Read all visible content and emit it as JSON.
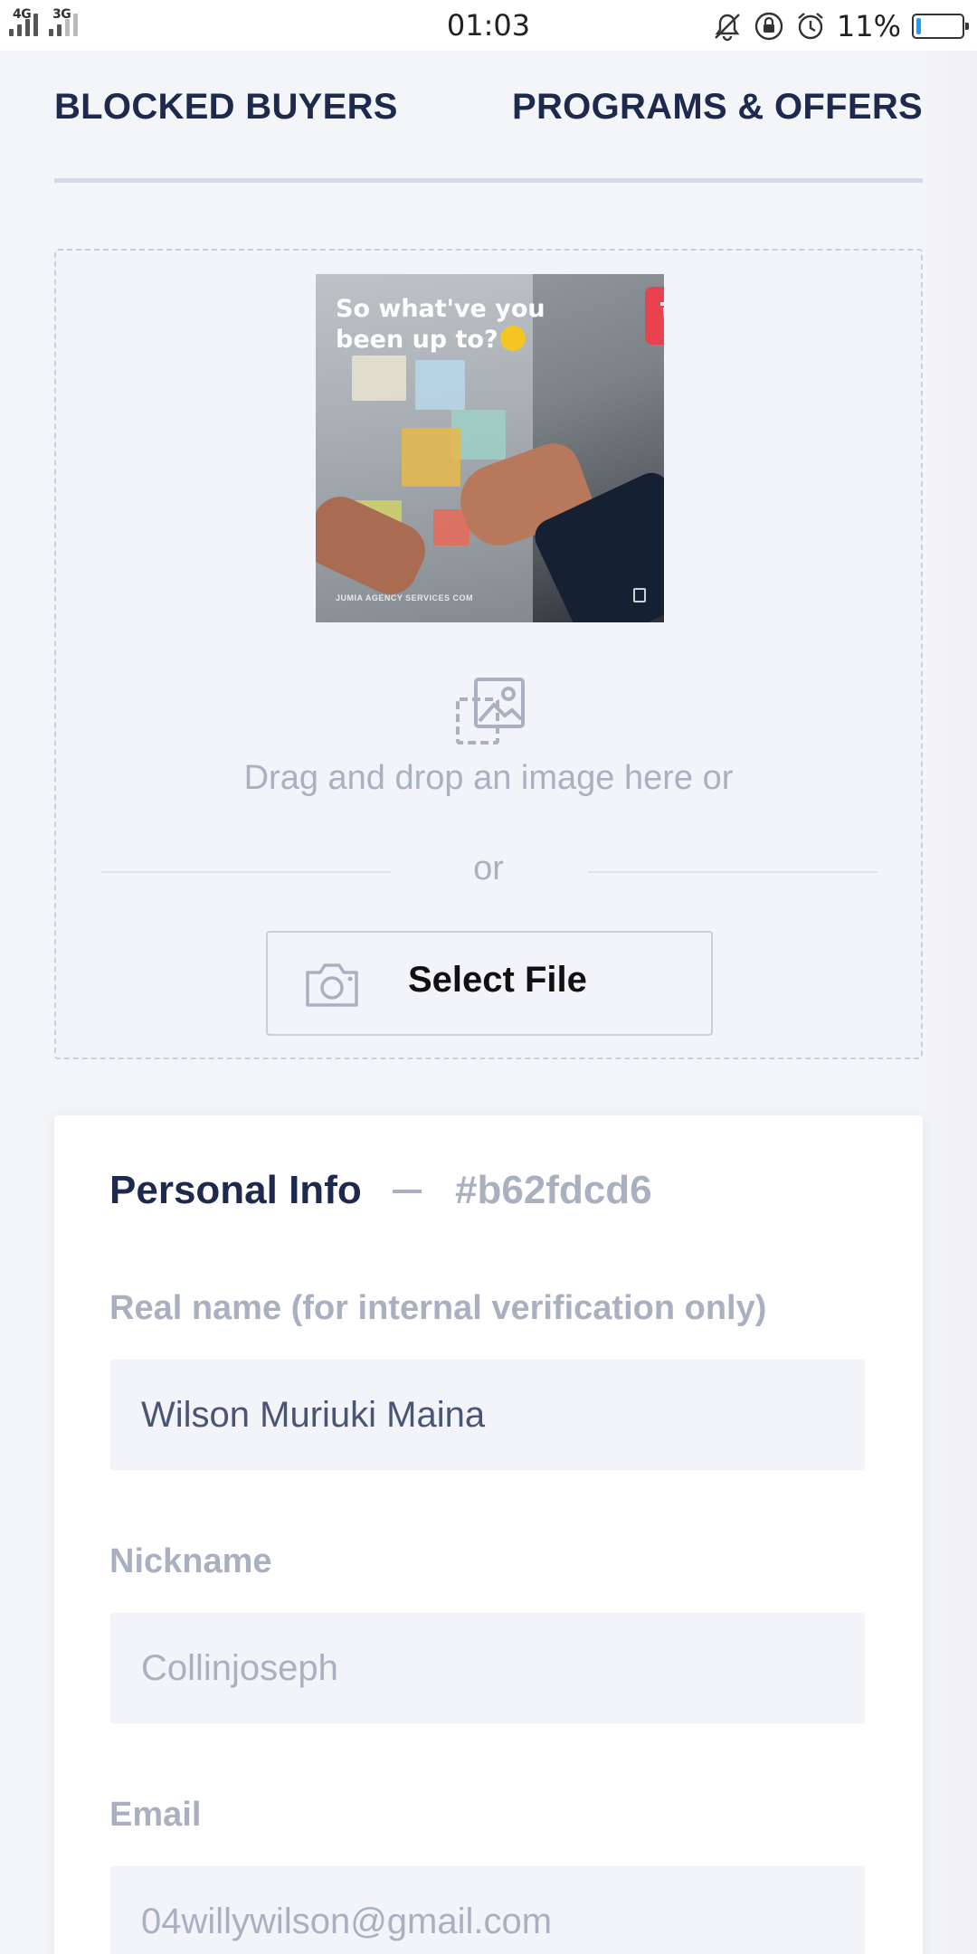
{
  "status_bar": {
    "network_1": "4G",
    "network_2": "3G",
    "time": "01:03",
    "battery": "11%",
    "battery_level": 0.11,
    "icons": [
      "mute-bell-icon",
      "lock-rotation-icon",
      "alarm-icon",
      "battery-icon"
    ]
  },
  "tabs": {
    "left": "BLOCKED BUYERS",
    "right": "PROGRAMS & OFFERS"
  },
  "upload": {
    "preview_caption": "So what've you been up to?",
    "preview_watermark": "JUMIA AGENCY SERVICES COM",
    "drag_text": "Drag and drop an image here or",
    "or_text": "or",
    "select_label": "Select File"
  },
  "personal_info": {
    "title": "Personal Info",
    "id": "#b62fdcd6",
    "real_name_label": "Real name (for internal verification only)",
    "real_name_value": "Wilson Muriuki Maina",
    "nickname_label": "Nickname",
    "nickname_value": "Collinjoseph",
    "email_label": "Email",
    "email_value": "04willywilson@gmail.com"
  },
  "colors": {
    "navy": "#1d2a4d",
    "muted": "#a9b1c1",
    "field_bg": "#f3f4f9",
    "delete_red": "#e8424f",
    "battery_blue": "#1e9bff"
  }
}
